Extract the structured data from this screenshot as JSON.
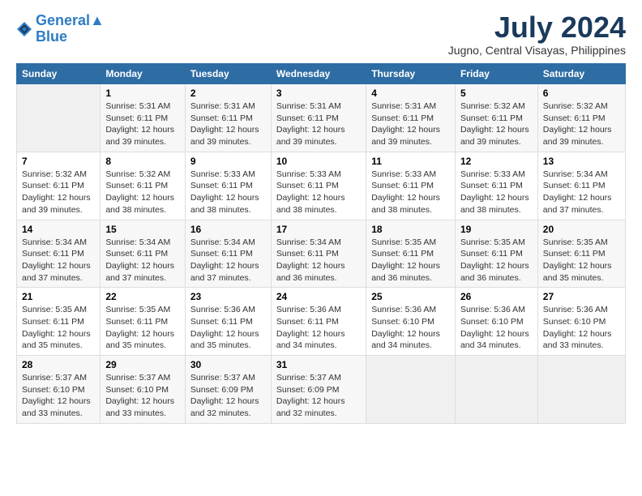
{
  "logo": {
    "line1": "General",
    "line2": "Blue"
  },
  "title": "July 2024",
  "location": "Jugno, Central Visayas, Philippines",
  "weekdays": [
    "Sunday",
    "Monday",
    "Tuesday",
    "Wednesday",
    "Thursday",
    "Friday",
    "Saturday"
  ],
  "weeks": [
    [
      {
        "day": "",
        "sunrise": "",
        "sunset": "",
        "daylight": ""
      },
      {
        "day": "1",
        "sunrise": "Sunrise: 5:31 AM",
        "sunset": "Sunset: 6:11 PM",
        "daylight": "Daylight: 12 hours and 39 minutes."
      },
      {
        "day": "2",
        "sunrise": "Sunrise: 5:31 AM",
        "sunset": "Sunset: 6:11 PM",
        "daylight": "Daylight: 12 hours and 39 minutes."
      },
      {
        "day": "3",
        "sunrise": "Sunrise: 5:31 AM",
        "sunset": "Sunset: 6:11 PM",
        "daylight": "Daylight: 12 hours and 39 minutes."
      },
      {
        "day": "4",
        "sunrise": "Sunrise: 5:31 AM",
        "sunset": "Sunset: 6:11 PM",
        "daylight": "Daylight: 12 hours and 39 minutes."
      },
      {
        "day": "5",
        "sunrise": "Sunrise: 5:32 AM",
        "sunset": "Sunset: 6:11 PM",
        "daylight": "Daylight: 12 hours and 39 minutes."
      },
      {
        "day": "6",
        "sunrise": "Sunrise: 5:32 AM",
        "sunset": "Sunset: 6:11 PM",
        "daylight": "Daylight: 12 hours and 39 minutes."
      }
    ],
    [
      {
        "day": "7",
        "sunrise": "Sunrise: 5:32 AM",
        "sunset": "Sunset: 6:11 PM",
        "daylight": "Daylight: 12 hours and 39 minutes."
      },
      {
        "day": "8",
        "sunrise": "Sunrise: 5:32 AM",
        "sunset": "Sunset: 6:11 PM",
        "daylight": "Daylight: 12 hours and 38 minutes."
      },
      {
        "day": "9",
        "sunrise": "Sunrise: 5:33 AM",
        "sunset": "Sunset: 6:11 PM",
        "daylight": "Daylight: 12 hours and 38 minutes."
      },
      {
        "day": "10",
        "sunrise": "Sunrise: 5:33 AM",
        "sunset": "Sunset: 6:11 PM",
        "daylight": "Daylight: 12 hours and 38 minutes."
      },
      {
        "day": "11",
        "sunrise": "Sunrise: 5:33 AM",
        "sunset": "Sunset: 6:11 PM",
        "daylight": "Daylight: 12 hours and 38 minutes."
      },
      {
        "day": "12",
        "sunrise": "Sunrise: 5:33 AM",
        "sunset": "Sunset: 6:11 PM",
        "daylight": "Daylight: 12 hours and 38 minutes."
      },
      {
        "day": "13",
        "sunrise": "Sunrise: 5:34 AM",
        "sunset": "Sunset: 6:11 PM",
        "daylight": "Daylight: 12 hours and 37 minutes."
      }
    ],
    [
      {
        "day": "14",
        "sunrise": "Sunrise: 5:34 AM",
        "sunset": "Sunset: 6:11 PM",
        "daylight": "Daylight: 12 hours and 37 minutes."
      },
      {
        "day": "15",
        "sunrise": "Sunrise: 5:34 AM",
        "sunset": "Sunset: 6:11 PM",
        "daylight": "Daylight: 12 hours and 37 minutes."
      },
      {
        "day": "16",
        "sunrise": "Sunrise: 5:34 AM",
        "sunset": "Sunset: 6:11 PM",
        "daylight": "Daylight: 12 hours and 37 minutes."
      },
      {
        "day": "17",
        "sunrise": "Sunrise: 5:34 AM",
        "sunset": "Sunset: 6:11 PM",
        "daylight": "Daylight: 12 hours and 36 minutes."
      },
      {
        "day": "18",
        "sunrise": "Sunrise: 5:35 AM",
        "sunset": "Sunset: 6:11 PM",
        "daylight": "Daylight: 12 hours and 36 minutes."
      },
      {
        "day": "19",
        "sunrise": "Sunrise: 5:35 AM",
        "sunset": "Sunset: 6:11 PM",
        "daylight": "Daylight: 12 hours and 36 minutes."
      },
      {
        "day": "20",
        "sunrise": "Sunrise: 5:35 AM",
        "sunset": "Sunset: 6:11 PM",
        "daylight": "Daylight: 12 hours and 35 minutes."
      }
    ],
    [
      {
        "day": "21",
        "sunrise": "Sunrise: 5:35 AM",
        "sunset": "Sunset: 6:11 PM",
        "daylight": "Daylight: 12 hours and 35 minutes."
      },
      {
        "day": "22",
        "sunrise": "Sunrise: 5:35 AM",
        "sunset": "Sunset: 6:11 PM",
        "daylight": "Daylight: 12 hours and 35 minutes."
      },
      {
        "day": "23",
        "sunrise": "Sunrise: 5:36 AM",
        "sunset": "Sunset: 6:11 PM",
        "daylight": "Daylight: 12 hours and 35 minutes."
      },
      {
        "day": "24",
        "sunrise": "Sunrise: 5:36 AM",
        "sunset": "Sunset: 6:11 PM",
        "daylight": "Daylight: 12 hours and 34 minutes."
      },
      {
        "day": "25",
        "sunrise": "Sunrise: 5:36 AM",
        "sunset": "Sunset: 6:10 PM",
        "daylight": "Daylight: 12 hours and 34 minutes."
      },
      {
        "day": "26",
        "sunrise": "Sunrise: 5:36 AM",
        "sunset": "Sunset: 6:10 PM",
        "daylight": "Daylight: 12 hours and 34 minutes."
      },
      {
        "day": "27",
        "sunrise": "Sunrise: 5:36 AM",
        "sunset": "Sunset: 6:10 PM",
        "daylight": "Daylight: 12 hours and 33 minutes."
      }
    ],
    [
      {
        "day": "28",
        "sunrise": "Sunrise: 5:37 AM",
        "sunset": "Sunset: 6:10 PM",
        "daylight": "Daylight: 12 hours and 33 minutes."
      },
      {
        "day": "29",
        "sunrise": "Sunrise: 5:37 AM",
        "sunset": "Sunset: 6:10 PM",
        "daylight": "Daylight: 12 hours and 33 minutes."
      },
      {
        "day": "30",
        "sunrise": "Sunrise: 5:37 AM",
        "sunset": "Sunset: 6:09 PM",
        "daylight": "Daylight: 12 hours and 32 minutes."
      },
      {
        "day": "31",
        "sunrise": "Sunrise: 5:37 AM",
        "sunset": "Sunset: 6:09 PM",
        "daylight": "Daylight: 12 hours and 32 minutes."
      },
      {
        "day": "",
        "sunrise": "",
        "sunset": "",
        "daylight": ""
      },
      {
        "day": "",
        "sunrise": "",
        "sunset": "",
        "daylight": ""
      },
      {
        "day": "",
        "sunrise": "",
        "sunset": "",
        "daylight": ""
      }
    ]
  ]
}
